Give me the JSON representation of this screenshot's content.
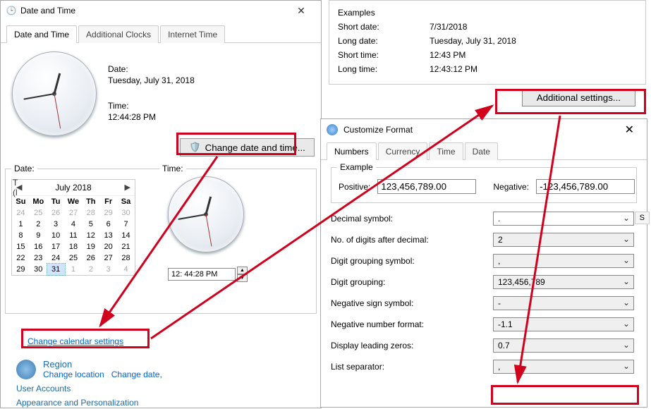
{
  "dtWindow": {
    "title": "Date and Time",
    "tabs": {
      "dt": "Date and Time",
      "ac": "Additional Clocks",
      "it": "Internet Time"
    },
    "dateLabel": "Date:",
    "dateValue": "Tuesday, July 31, 2018",
    "timeLabel": "Time:",
    "timeValue": "12:44:28 PM",
    "changeDtBtn": "Change date and time...",
    "subDateLabel": "Date:",
    "subTimeLabel": "Time:",
    "calTitle": "July 2018",
    "dow": [
      "Su",
      "Mo",
      "Tu",
      "We",
      "Th",
      "Fr",
      "Sa"
    ],
    "calRows": [
      [
        {
          "d": "24",
          "o": true
        },
        {
          "d": "25",
          "o": true
        },
        {
          "d": "26",
          "o": true
        },
        {
          "d": "27",
          "o": true
        },
        {
          "d": "28",
          "o": true
        },
        {
          "d": "29",
          "o": true
        },
        {
          "d": "30",
          "o": true
        }
      ],
      [
        {
          "d": "1"
        },
        {
          "d": "2"
        },
        {
          "d": "3"
        },
        {
          "d": "4"
        },
        {
          "d": "5"
        },
        {
          "d": "6"
        },
        {
          "d": "7"
        }
      ],
      [
        {
          "d": "8"
        },
        {
          "d": "9"
        },
        {
          "d": "10"
        },
        {
          "d": "11"
        },
        {
          "d": "12"
        },
        {
          "d": "13"
        },
        {
          "d": "14"
        }
      ],
      [
        {
          "d": "15"
        },
        {
          "d": "16"
        },
        {
          "d": "17"
        },
        {
          "d": "18"
        },
        {
          "d": "19"
        },
        {
          "d": "20"
        },
        {
          "d": "21"
        }
      ],
      [
        {
          "d": "22"
        },
        {
          "d": "23"
        },
        {
          "d": "24"
        },
        {
          "d": "25"
        },
        {
          "d": "26"
        },
        {
          "d": "27"
        },
        {
          "d": "28"
        }
      ],
      [
        {
          "d": "29"
        },
        {
          "d": "30"
        },
        {
          "d": "31",
          "sel": true
        },
        {
          "d": "1",
          "o": true
        },
        {
          "d": "2",
          "o": true
        },
        {
          "d": "3",
          "o": true
        },
        {
          "d": "4",
          "o": true
        }
      ]
    ],
    "timeInput": "12: 44:28 PM",
    "changeCalendar": "Change calendar settings",
    "region": {
      "title": "Region",
      "changeLoc": "Change location",
      "changeDate": "Change date,"
    },
    "userAccounts": "User Accounts",
    "appearance": "Appearance and Personalization"
  },
  "examples": {
    "title": "Examples",
    "rows": {
      "shortDateLbl": "Short date:",
      "shortDate": "7/31/2018",
      "longDateLbl": "Long date:",
      "longDate": "Tuesday, July 31, 2018",
      "shortTimeLbl": "Short time:",
      "shortTime": "12:43 PM",
      "longTimeLbl": "Long time:",
      "longTime": "12:43:12 PM"
    },
    "additionalBtn": "Additional settings..."
  },
  "cf": {
    "title": "Customize Format",
    "tabs": {
      "num": "Numbers",
      "cur": "Currency",
      "time": "Time",
      "date": "Date"
    },
    "example": {
      "title": "Example",
      "posLbl": "Positive:",
      "posVal": "123,456,789.00",
      "negLbl": "Negative:",
      "negVal": "-123,456,789.00"
    },
    "fields": {
      "decSymLbl": "Decimal symbol:",
      "decSym": ".",
      "digitsLbl": "No. of digits after decimal:",
      "digits": "2",
      "groupSymLbl": "Digit grouping symbol:",
      "groupSym": ",",
      "groupingLbl": "Digit grouping:",
      "grouping": "123,456,789",
      "negSymLbl": "Negative sign symbol:",
      "negSym": "-",
      "negFmtLbl": "Negative number format:",
      "negFmt": "-1.1",
      "leadZeroLbl": "Display leading zeros:",
      "leadZero": "0.7",
      "listSepLbl": "List separator:",
      "listSep": ","
    }
  },
  "sBtn": "S"
}
